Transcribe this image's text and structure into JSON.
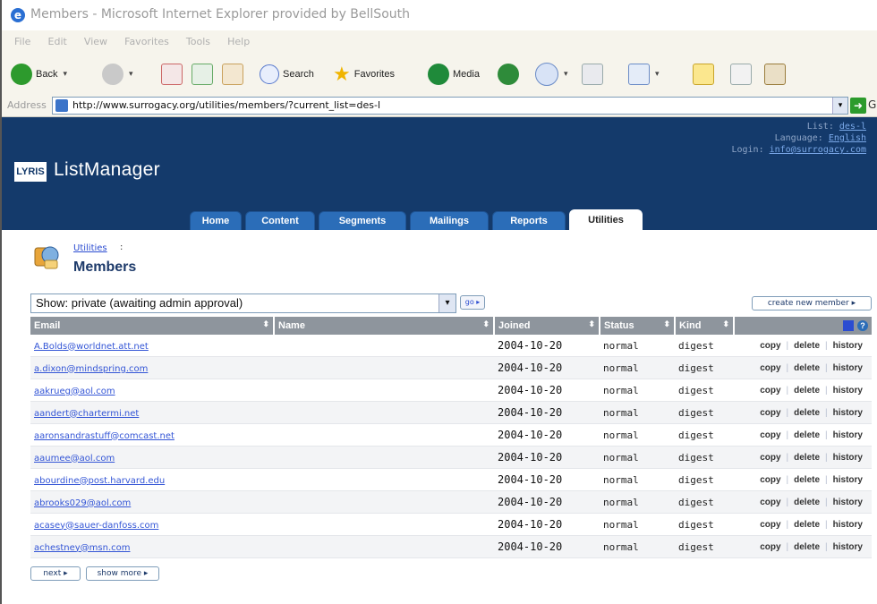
{
  "window": {
    "title": "Members - Microsoft Internet Explorer provided by BellSouth"
  },
  "menu": [
    "File",
    "Edit",
    "View",
    "Favorites",
    "Tools",
    "Help"
  ],
  "toolbar": {
    "back_label": "Back",
    "search_label": "Search",
    "favorites_label": "Favorites",
    "media_label": "Media"
  },
  "address": {
    "label": "Address",
    "url": "http://www.surrogacy.org/utilities/members/?current_list=des-l"
  },
  "header": {
    "logo_text": "LYRIS",
    "app_title": "ListManager",
    "list_label": "List:",
    "list_value": "des-l",
    "language_label": "Language:",
    "language_value": "English",
    "login_label": "Login:",
    "login_value": "info@surrogacy.com"
  },
  "tabs": [
    {
      "label": "Home",
      "active": false
    },
    {
      "label": "Content",
      "active": false
    },
    {
      "label": "Segments",
      "active": false
    },
    {
      "label": "Mailings",
      "active": false
    },
    {
      "label": "Reports",
      "active": false
    },
    {
      "label": "Utilities",
      "active": true
    }
  ],
  "page": {
    "breadcrumb": "Utilities",
    "breadcrumb_sep": ":",
    "title": "Members",
    "show_select": "Show: private (awaiting admin approval)",
    "go_label": "go ▸",
    "create_label": "create new member ▸",
    "next_label": "next ▸",
    "show_more_label": "show more ▸"
  },
  "table": {
    "columns": [
      "Email",
      "Name",
      "Joined",
      "Status",
      "Kind"
    ],
    "action_labels": {
      "copy": "copy",
      "delete": "delete",
      "history": "history"
    },
    "rows": [
      {
        "email": "A.Bolds@worldnet.att.net",
        "name": "",
        "joined": "2004-10-20",
        "status": "normal",
        "kind": "digest"
      },
      {
        "email": "a.dixon@mindspring.com",
        "name": "",
        "joined": "2004-10-20",
        "status": "normal",
        "kind": "digest"
      },
      {
        "email": "aakrueg@aol.com",
        "name": "",
        "joined": "2004-10-20",
        "status": "normal",
        "kind": "digest"
      },
      {
        "email": "aandert@chartermi.net",
        "name": "",
        "joined": "2004-10-20",
        "status": "normal",
        "kind": "digest"
      },
      {
        "email": "aaronsandrastuff@comcast.net",
        "name": "",
        "joined": "2004-10-20",
        "status": "normal",
        "kind": "digest"
      },
      {
        "email": "aaumee@aol.com",
        "name": "",
        "joined": "2004-10-20",
        "status": "normal",
        "kind": "digest"
      },
      {
        "email": "abourdine@post.harvard.edu",
        "name": "",
        "joined": "2004-10-20",
        "status": "normal",
        "kind": "digest"
      },
      {
        "email": "abrooks029@aol.com",
        "name": "",
        "joined": "2004-10-20",
        "status": "normal",
        "kind": "digest"
      },
      {
        "email": "acasey@sauer-danfoss.com",
        "name": "",
        "joined": "2004-10-20",
        "status": "normal",
        "kind": "digest"
      },
      {
        "email": "achestney@msn.com",
        "name": "",
        "joined": "2004-10-20",
        "status": "normal",
        "kind": "digest"
      }
    ]
  },
  "colors": {
    "header_bg": "#143a6b",
    "tab_bg": "#2b6db8",
    "table_header_bg": "#8e959d",
    "link": "#3355d6"
  }
}
